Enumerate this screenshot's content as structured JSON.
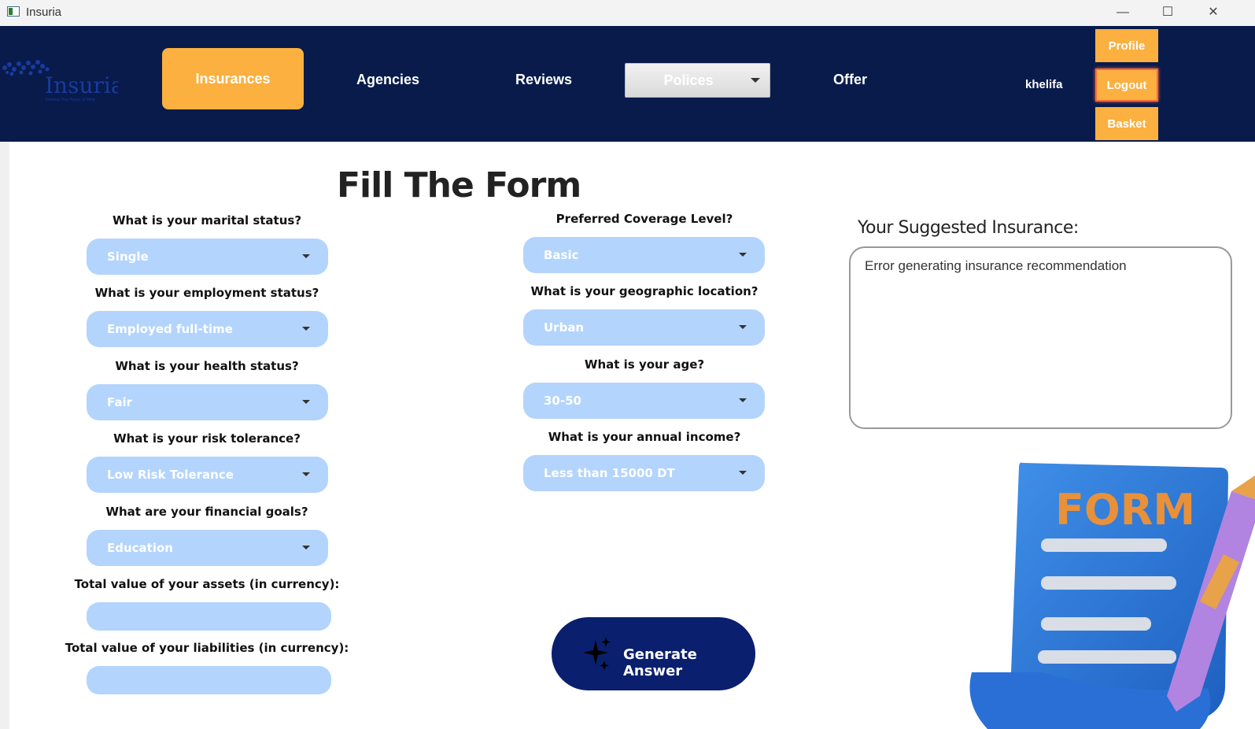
{
  "window": {
    "title": "Insuria",
    "minimize": "—",
    "maximize": "☐",
    "close": "✕"
  },
  "nav": {
    "logo_text": "Insuria",
    "logo_tagline": "Insuring Your Peace of Mind",
    "insurances": "Insurances",
    "agencies": "Agencies",
    "reviews": "Reviews",
    "polices": "Polices",
    "offer": "Offer",
    "username": "khelifa",
    "profile": "Profile",
    "logout": "Logout",
    "basket": "Basket",
    "accent_color": "#fbb040",
    "bar_color": "#081b4b"
  },
  "form": {
    "title": "Fill The Form",
    "marital": {
      "label": "What is your marital status?",
      "value": "Single"
    },
    "employment": {
      "label": "What is your employment status?",
      "value": "Employed full-time"
    },
    "health": {
      "label": "What is your health status?",
      "value": "Fair"
    },
    "risk": {
      "label": "What is your risk tolerance?",
      "value": "Low Risk Tolerance"
    },
    "goals": {
      "label": "What are your financial goals?",
      "value": "Education"
    },
    "assets": {
      "label": "Total value of your assets (in currency):",
      "value": ""
    },
    "liabilities": {
      "label": "Total value of your liabilities (in currency):",
      "value": ""
    },
    "coverage": {
      "label": "Preferred Coverage Level?",
      "value": "Basic"
    },
    "location": {
      "label": "What is your geographic location?",
      "value": "Urban"
    },
    "age": {
      "label": "What is your age?",
      "value": "30-50"
    },
    "income": {
      "label": "What is your annual income?",
      "value": "Less than 15000 DT"
    },
    "generate": "Generate Answer"
  },
  "suggestion": {
    "title": "Your Suggested Insurance:",
    "message": "Error generating insurance recommendation"
  },
  "illustration": {
    "text": "FORM"
  }
}
